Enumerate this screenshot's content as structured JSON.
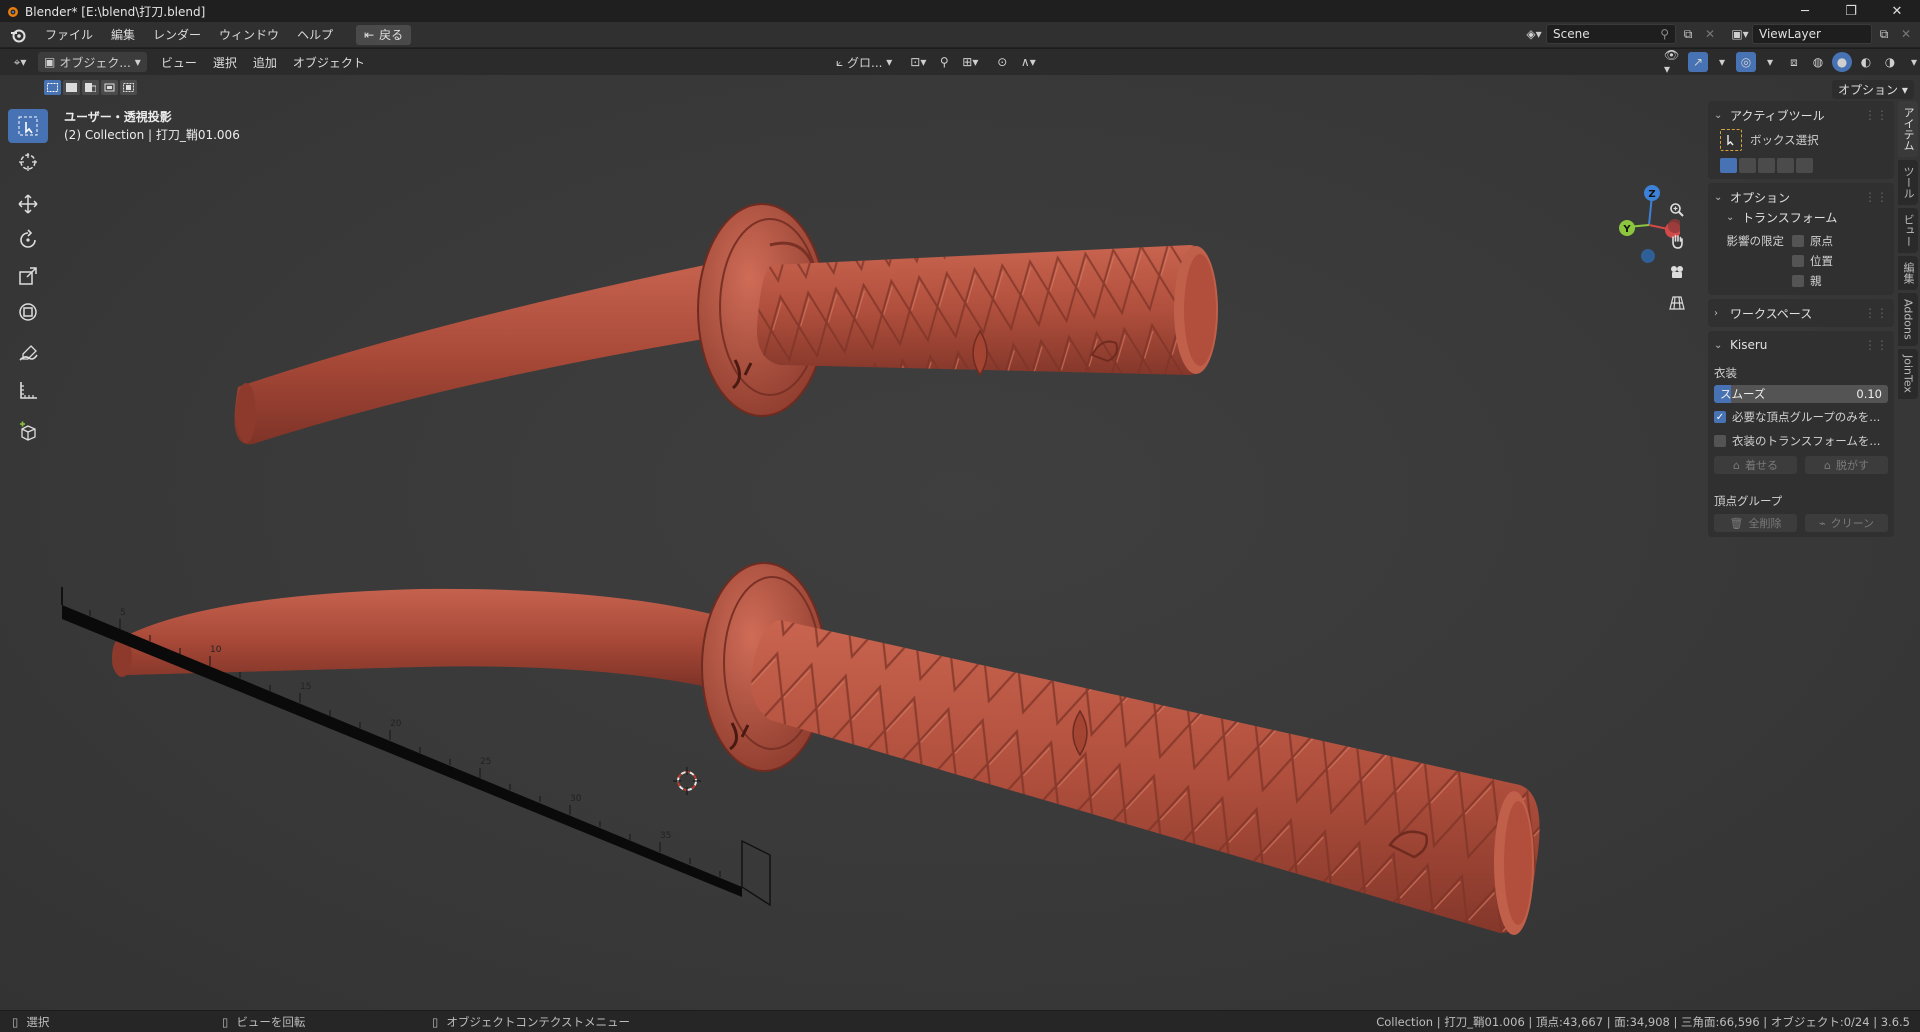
{
  "window": {
    "title": "Blender* [E:\\blend\\打刀.blend]",
    "controls": [
      "─",
      "❐",
      "✕"
    ]
  },
  "menubar": {
    "items": [
      "ファイル",
      "編集",
      "レンダー",
      "ウィンドウ",
      "ヘルプ"
    ],
    "back_label": "戻る",
    "scene_name": "Scene",
    "view_layer": "ViewLayer"
  },
  "viewport_header": {
    "mode": "オブジェク...",
    "items": [
      "ビュー",
      "選択",
      "追加",
      "オブジェクト"
    ],
    "transform_orientation": "グロ...",
    "options_label": "オプション"
  },
  "viewport": {
    "view_name": "ユーザー・透視投影",
    "collection_info": "(2) Collection | 打刀_鞘01.006",
    "gizmo_axes": {
      "z": "Z",
      "y": "Y"
    },
    "ruler_labels": [
      "5",
      "10",
      "15",
      "20",
      "25",
      "30",
      "35"
    ]
  },
  "npanel": {
    "active_tool_title": "アクティブツール",
    "active_tool_name": "ボックス選択",
    "options_title": "オプション",
    "transform_title": "トランスフォーム",
    "affect_only_label": "影響の限定",
    "affect_checks": [
      {
        "label": "原点",
        "checked": false
      },
      {
        "label": "位置",
        "checked": false
      },
      {
        "label": "親",
        "checked": false
      }
    ],
    "workspace_title": "ワークスペース",
    "kiseru_title": "Kiseru",
    "costume_label": "衣装",
    "smooth_label": "スムーズ",
    "smooth_value": "0.10",
    "smooth_fraction": 0.1,
    "check_vertex_groups": {
      "label": "必要な頂点グループのみを...",
      "checked": true
    },
    "check_costume_transform": {
      "label": "衣装のトランスフォームを...",
      "checked": false
    },
    "wear_button": "着せる",
    "undress_button": "脱がす",
    "vertex_group_label": "頂点グループ",
    "delete_all_button": "全削除",
    "clean_button": "クリーン"
  },
  "sidetabs": [
    "アイテム",
    "ツール",
    "ビュー",
    "編集",
    "Addons",
    "JoinTex"
  ],
  "statusbar": {
    "select": "選択",
    "rotate_view": "ビューを回転",
    "context_menu": "オブジェクトコンテクストメニュー",
    "stats": "Collection | 打刀_鞘01.006 | 頂点:43,667 | 面:34,908 | 三角面:66,596 | オブジェクト:0/24 | 3.6.5"
  },
  "colors": {
    "accent": "#4772b3",
    "model": "#b5503f",
    "axis_x": "#d04a4a",
    "axis_y": "#8cc63e",
    "axis_z": "#3d82d6"
  }
}
